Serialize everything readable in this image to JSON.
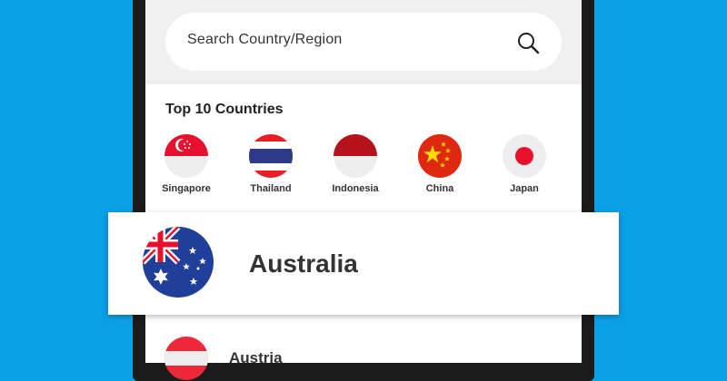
{
  "search": {
    "placeholder": "Search Country/Region"
  },
  "top_countries": {
    "title": "Top 10 Countries",
    "items": [
      {
        "label": "Singapore",
        "icon": "singapore-flag-icon"
      },
      {
        "label": "Thailand",
        "icon": "thailand-flag-icon"
      },
      {
        "label": "Indonesia",
        "icon": "indonesia-flag-icon"
      },
      {
        "label": "China",
        "icon": "china-flag-icon"
      },
      {
        "label": "Japan",
        "icon": "japan-flag-icon"
      }
    ]
  },
  "highlight": {
    "label": "Australia",
    "icon": "australia-flag-icon"
  },
  "list": [
    {
      "label": "Austria",
      "icon": "austria-flag-icon"
    }
  ],
  "colors": {
    "background": "#0aa0e6",
    "phone_frame": "#1b1b1b",
    "search_area": "#f0f0f0"
  }
}
